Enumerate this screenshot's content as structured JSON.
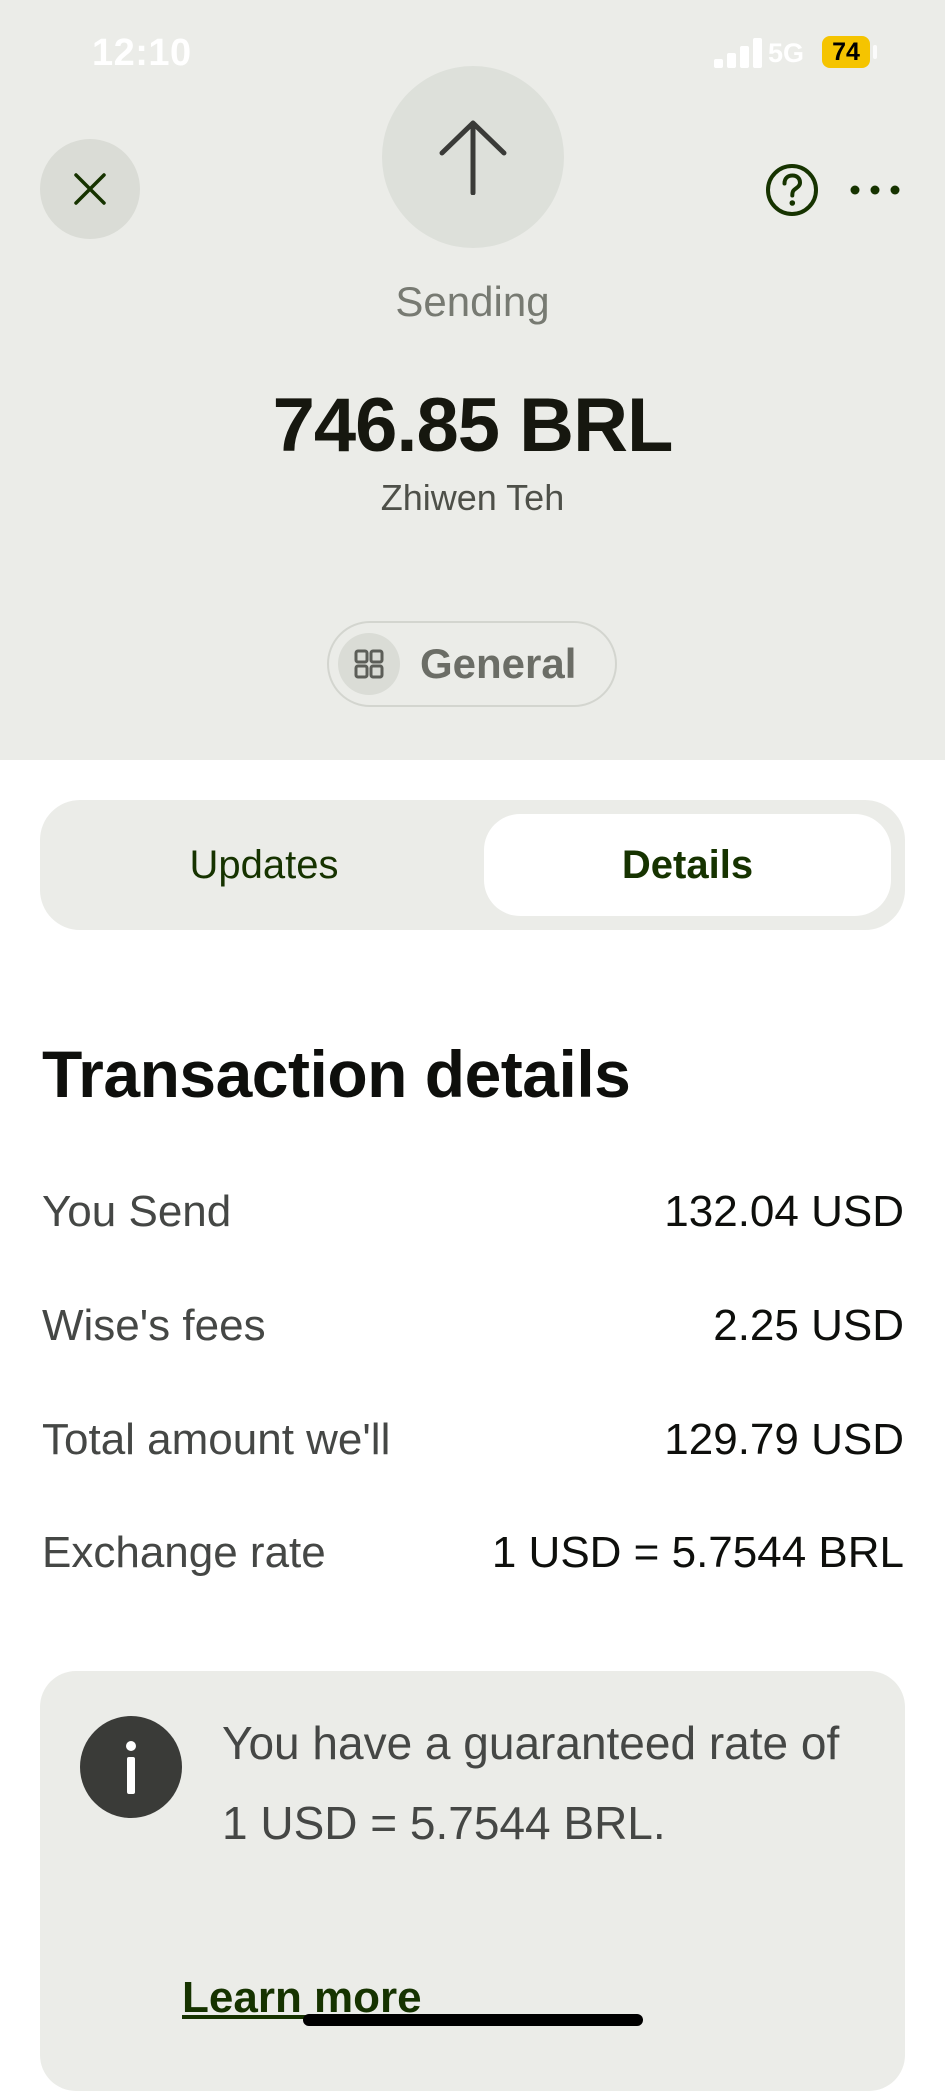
{
  "status_bar": {
    "time": "12:10",
    "network": "5G",
    "battery": "74"
  },
  "header": {
    "close_icon": "close-icon",
    "help_icon": "question-circle-icon",
    "more_icon": "more-horizontal-icon",
    "transfer_icon": "arrow-up-icon",
    "status": "Sending",
    "amount": "746.85 BRL",
    "recipient": "Zhiwen Teh",
    "category": {
      "icon": "grid-icon",
      "label": "General"
    }
  },
  "tabs": [
    {
      "label": "Updates",
      "selected": false
    },
    {
      "label": "Details",
      "selected": true
    }
  ],
  "details": {
    "title": "Transaction details",
    "rows": [
      {
        "label": "You Send",
        "value": "132.04 USD"
      },
      {
        "label": "Wise's fees",
        "value": "2.25 USD"
      },
      {
        "label": "Total amount we'll",
        "value": "129.79 USD"
      },
      {
        "label": "Exchange rate",
        "value": "1 USD = 5.7544 BRL"
      }
    ]
  },
  "info_card": {
    "icon": "info-icon",
    "text": "You have a guaranteed rate of 1 USD = 5.7544 BRL.",
    "link": "Learn more"
  },
  "colors": {
    "header_bg": "#ebece8",
    "accent_dark_green": "#163300",
    "text_primary": "#0e0f0c",
    "text_secondary": "#454745"
  }
}
